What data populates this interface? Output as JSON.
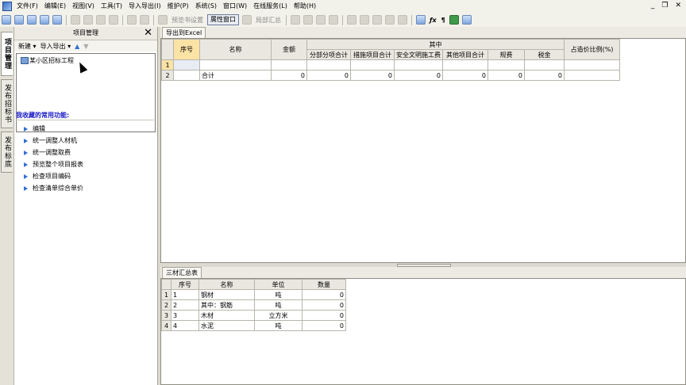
{
  "menu": [
    "文件(F)",
    "编辑(E)",
    "视图(V)",
    "工具(T)",
    "导入导出(I)",
    "维护(P)",
    "系统(S)",
    "窗口(W)",
    "在线服务(L)",
    "帮助(H)"
  ],
  "toolbar": {
    "preview_settings": "预览书设置",
    "props_window": "属性窗口",
    "local_summary": "局部汇总"
  },
  "vtabs": [
    "项目管理",
    "发布招标书",
    "发布标底"
  ],
  "left": {
    "title": "项目管理",
    "new_label": "新建",
    "import_export_label": "导入导出",
    "tree_item": "某小区招标工程",
    "fav_title": "我收藏的常用功能:",
    "fav_items": [
      "编辑",
      "统一调整人材机",
      "统一调整取费",
      "预览整个项目报表",
      "检查项目编码",
      "检查清单综合单价"
    ]
  },
  "top_grid": {
    "tab": "导出到Excel",
    "headers": {
      "seq": "序号",
      "name": "名称",
      "amount": "金额",
      "group": "其中",
      "sub": [
        "分部分项合计",
        "措施项目合计",
        "安全文明施工费",
        "其他项目合计",
        "规费",
        "税金"
      ],
      "ratio": "占造价比例(%)"
    },
    "rows": [
      {
        "rownum": "1",
        "seq": "",
        "name": "",
        "amount": "",
        "v": [
          "",
          "",
          "",
          "",
          "",
          ""
        ],
        "ratio": ""
      },
      {
        "rownum": "2",
        "seq": "",
        "name": "合计",
        "amount": "0",
        "v": [
          "0",
          "0",
          "0",
          "0",
          "0",
          "0"
        ],
        "ratio": ""
      }
    ]
  },
  "bottom_grid": {
    "tab": "三材汇总表",
    "headers": [
      "序号",
      "名称",
      "单位",
      "数量"
    ],
    "rows": [
      {
        "rownum": "1",
        "seq": "1",
        "name": "钢材",
        "unit": "吨",
        "qty": "0"
      },
      {
        "rownum": "2",
        "seq": "2",
        "name": "其中：钢筋",
        "unit": "吨",
        "qty": "0"
      },
      {
        "rownum": "3",
        "seq": "3",
        "name": "木材",
        "unit": "立方米",
        "qty": "0"
      },
      {
        "rownum": "4",
        "seq": "4",
        "name": "水泥",
        "unit": "吨",
        "qty": "0"
      }
    ]
  }
}
